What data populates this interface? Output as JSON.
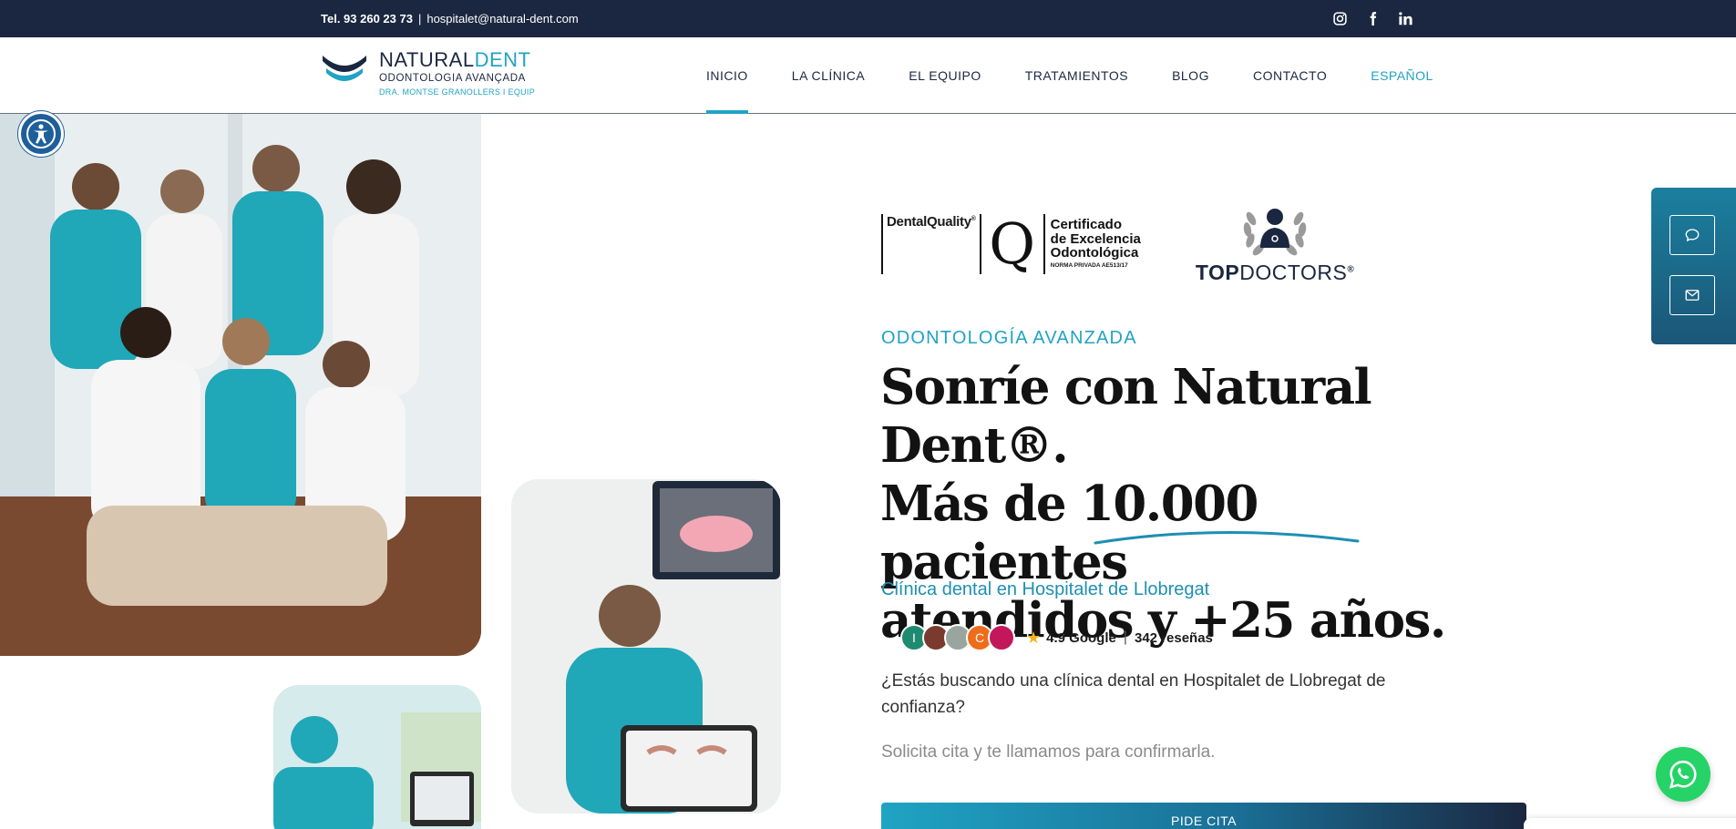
{
  "topbar": {
    "phone": "Tel. 93 260 23 73",
    "separator": "|",
    "email": "hospitalet@natural-dent.com",
    "social": [
      "instagram-icon",
      "facebook-icon",
      "linkedin-icon"
    ]
  },
  "logo": {
    "brand_part1": "NATURAL",
    "brand_part2": "DENT",
    "line1": "ODONTOLOGIA AVANÇADA",
    "line2": "DRA. MONTSE GRANOLLERS I EQUIP"
  },
  "nav": {
    "items": [
      {
        "label": "INICIO",
        "active": true
      },
      {
        "label": "LA CLÍNICA",
        "active": false
      },
      {
        "label": "EL EQUIPO",
        "active": false
      },
      {
        "label": "TRATAMIENTOS",
        "active": false
      },
      {
        "label": "BLOG",
        "active": false
      },
      {
        "label": "CONTACTO",
        "active": false
      }
    ],
    "language": "ESPAÑOL"
  },
  "badges": {
    "dental_quality": "DentalQuality",
    "registered": "®",
    "q_letter": "Q",
    "cert_line1": "Certificado",
    "cert_line2": "de Excelencia",
    "cert_line3": "Odontológica",
    "norma": "NORMA PRIVADA AE513/17",
    "topdoctors_part1": "TOP",
    "topdoctors_part2": "DOCTORS",
    "topdoctors_mark": "®"
  },
  "hero": {
    "eyebrow": "ODONTOLOGÍA AVANZADA",
    "headline_line1": "Sonríe con Natural Dent®.",
    "headline_line2": "Más de 10.000 pacientes",
    "headline_line3": "atendidos y +25 años.",
    "subhead": "Clínica dental en Hospitalet de Llobregat",
    "rating": "4.9 Google",
    "review_sep": "|",
    "reviews_count": "342 reseñas",
    "body1": "¿Estás buscando una clínica dental en Hospitalet de Llobregat de confianza?",
    "body2": "Solicita cita y te llamamos para confirmarla.",
    "cta": "PIDE CITA"
  },
  "avatars": [
    {
      "letter": "I",
      "color": "#1f8a70"
    },
    {
      "letter": "",
      "color": "#7a3b2e"
    },
    {
      "letter": "",
      "color": "#9aa5a0"
    },
    {
      "letter": "C",
      "color": "#ef6c1a"
    },
    {
      "letter": "",
      "color": "#c2185b"
    }
  ],
  "colors": {
    "navy": "#1b2740",
    "accent": "#21a3c4",
    "whatsapp": "#25d366",
    "star": "#f3b31a"
  }
}
